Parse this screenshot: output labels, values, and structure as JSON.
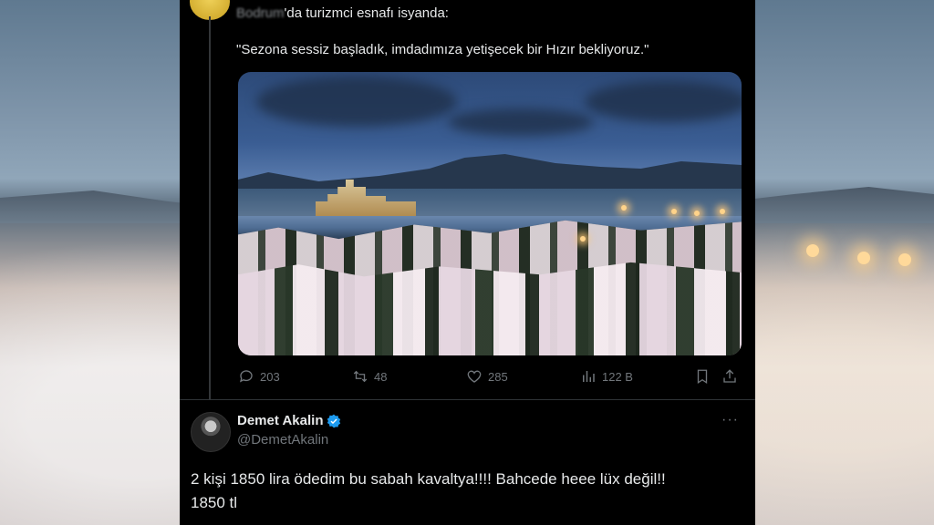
{
  "top_tweet": {
    "line1_blurred": "Bodrum",
    "line1_rest": "'da turizmci esnafı isyanda:",
    "quote": "\"Sezona sessiz başladık, imdadımıza yetişecek bir Hızır bekliyoruz.\""
  },
  "stats": {
    "replies": "203",
    "reposts": "48",
    "likes": "285",
    "views": "122 B"
  },
  "reply": {
    "name": "Demet Akalin",
    "handle": "@DemetAkalin",
    "more": "···",
    "text": "2 kişi 1850 lira ödedim bu sabah kavaltya!!!! Bahcede heee lüx değil!!\n1850 tl"
  },
  "colors": {
    "background": "#000000",
    "text": "#e7e9ea",
    "muted": "#71767b",
    "verified": "#1d9bf0"
  }
}
